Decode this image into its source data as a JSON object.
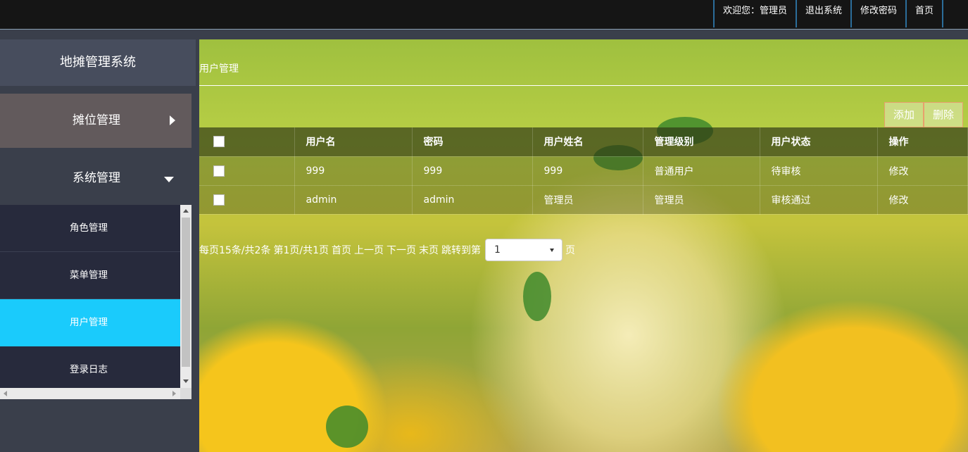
{
  "topbar": {
    "welcome": "欢迎您：管理员",
    "logout": "退出系统",
    "change_password": "修改密码",
    "home": "首页"
  },
  "sidebar": {
    "title": "地摊管理系统",
    "menus": [
      {
        "label": "摊位管理"
      },
      {
        "label": "系统管理"
      }
    ],
    "submenu": [
      {
        "label": "角色管理"
      },
      {
        "label": "菜单管理"
      },
      {
        "label": "用户管理",
        "active": true
      },
      {
        "label": "登录日志"
      }
    ]
  },
  "main": {
    "breadcrumb": "用户管理",
    "buttons": {
      "add": "添加",
      "delete": "删除"
    },
    "table": {
      "headers": [
        "用户名",
        "密码",
        "用户姓名",
        "管理级别",
        "用户状态",
        "操作"
      ],
      "rows": [
        [
          "999",
          "999",
          "999",
          "普通用户",
          "待审核",
          "修改"
        ],
        [
          "admin",
          "admin",
          "管理员",
          "管理员",
          "审核通过",
          "修改"
        ]
      ]
    },
    "pager": {
      "per_page": "每页15条/共2条",
      "page_info": "第1页/共1页",
      "first": "首页",
      "prev": "上一页",
      "next": "下一页",
      "last": "末页",
      "jump_prefix": "跳转到第",
      "page_value": "1",
      "jump_suffix": "页"
    }
  }
}
